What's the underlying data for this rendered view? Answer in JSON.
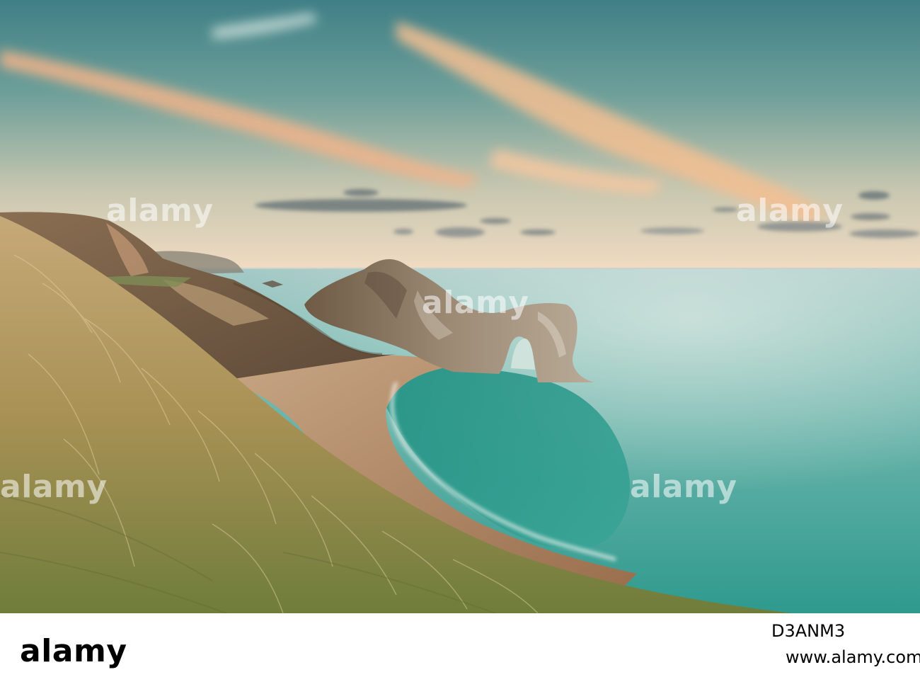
{
  "watermark": {
    "text": "alamy"
  },
  "footer": {
    "brand": "alamy",
    "image_id": "D3ANM3",
    "url": "www.alamy.com"
  },
  "colors": {
    "sky_top": "#4f8a8e",
    "sky_horizon": "#f3dcc0",
    "cloud_glow": "#f4b788",
    "sea": "#5fb6a6",
    "sand": "#b28a66",
    "grass": "#b49a62",
    "rock": "#8c7560"
  }
}
